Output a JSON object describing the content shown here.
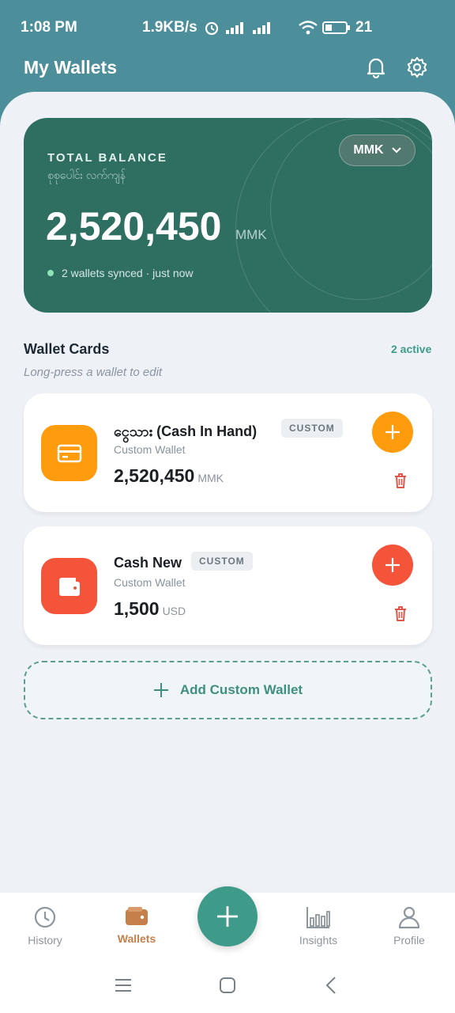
{
  "status": {
    "time": "1:08 PM",
    "speed": "1.9KB/s",
    "battery": "21"
  },
  "header": {
    "title": "My Wallets"
  },
  "balance": {
    "label": "TOTAL BALANCE",
    "sublabel": "စုစုပေါင်း လက်ကျန်",
    "amount": "2,520,450",
    "currency": "MMK",
    "sync_text": "2 wallets synced · just now",
    "selector": "MMK"
  },
  "section": {
    "title": "Wallet Cards",
    "active": "2 active",
    "hint": "Long-press a wallet to edit"
  },
  "wallets": [
    {
      "name": "ငွေသား  (Cash In Hand)",
      "badge": "CUSTOM",
      "type": "Custom Wallet",
      "amount": "2,520,450",
      "currency": "MMK",
      "color": "#ff9c0d"
    },
    {
      "name": "Cash New",
      "badge": "CUSTOM",
      "type": "Custom Wallet",
      "amount": "1,500",
      "currency": "USD",
      "color": "#f4553a"
    }
  ],
  "add_wallet": {
    "label": "Add Custom Wallet"
  },
  "nav": [
    {
      "label": "History",
      "icon": "clock-icon"
    },
    {
      "label": "Wallets",
      "icon": "wallet-icon"
    },
    {
      "label": "Insights",
      "icon": "bar-chart-icon"
    },
    {
      "label": "Profile",
      "icon": "person-icon"
    }
  ],
  "colors": {
    "header": "#4c8f9b",
    "card": "#2e6f62",
    "accent": "#3f9b89",
    "orange": "#ff9c0d",
    "red": "#f4553a",
    "nav_active": "#c47f4a"
  }
}
